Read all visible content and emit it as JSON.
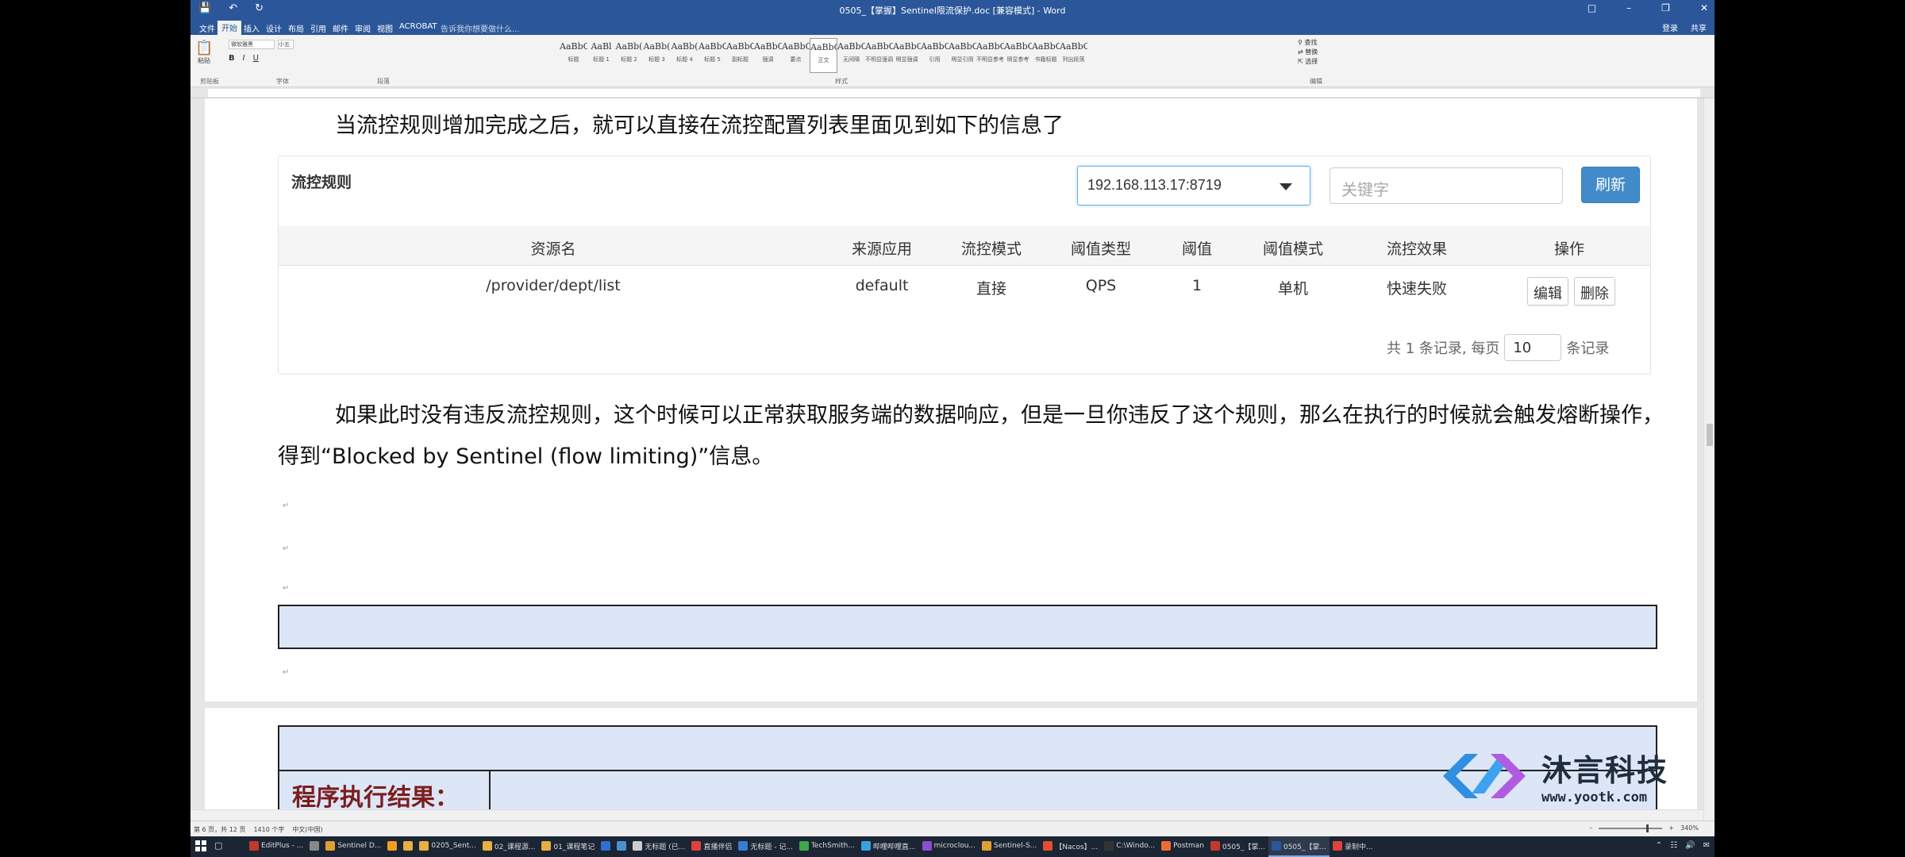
{
  "window": {
    "title": "0505_【掌握】Sentinel限流保护.doc [兼容模式] - Word",
    "login": "登录",
    "share": "共享"
  },
  "ribbon": {
    "tabs": [
      "文件",
      "开始",
      "插入",
      "设计",
      "布局",
      "引用",
      "邮件",
      "审阅",
      "视图",
      "ACROBAT"
    ],
    "active_tab": "开始",
    "tell_me": "告诉我你想要做什么...",
    "font_name": "微软雅黑",
    "font_size": "小五",
    "paste_label": "粘贴",
    "group_labels": [
      "剪贴板",
      "字体",
      "段落",
      "样式",
      "编辑"
    ],
    "styles": [
      {
        "preview": "AaBbC",
        "name": "标题"
      },
      {
        "preview": "AaBl",
        "name": "标题 1"
      },
      {
        "preview": "AaBb(",
        "name": "标题 2"
      },
      {
        "preview": "AaBb(",
        "name": "标题 3"
      },
      {
        "preview": "AaBb(",
        "name": "标题 4"
      },
      {
        "preview": "AaBbC",
        "name": "标题 5"
      },
      {
        "preview": "AaBbC",
        "name": "副标题"
      },
      {
        "preview": "AaBbCcD",
        "name": "强调"
      },
      {
        "preview": "AaBbCcD",
        "name": "要点"
      },
      {
        "preview": "AaBbCcD",
        "name": "正文"
      },
      {
        "preview": "AaBbCcD",
        "name": "无间隔"
      },
      {
        "preview": "AaBbCcD",
        "name": "不明显强调"
      },
      {
        "preview": "AaBbCcD",
        "name": "明显强调"
      },
      {
        "preview": "AaBbCcD",
        "name": "引用"
      },
      {
        "preview": "AaBbCcD",
        "name": "明显引用"
      },
      {
        "preview": "AaBbCcD",
        "name": "不明显参考"
      },
      {
        "preview": "AaBbCcI",
        "name": "明显参考"
      },
      {
        "preview": "AaBbCcD",
        "name": "书籍标题"
      },
      {
        "preview": "AaBbCcD",
        "name": "列出段落"
      }
    ],
    "edit_items": [
      "查找",
      "替换",
      "选择"
    ]
  },
  "document": {
    "para1": "当流控规则增加完成之后，就可以直接在流控配置列表里面见到如下的信息了",
    "para2": "如果此时没有违反流控规则，这个时候可以正常获取服务端的数据响应，但是一旦你违反了这个规则，那么在执行的时候就会触发熔断操作，得到“Blocked by Sentinel (flow limiting)”信息。",
    "result_label": "程序执行结果："
  },
  "flow_panel": {
    "title": "流控规则",
    "machine": "192.168.113.17:8719",
    "search_placeholder": "关键字",
    "refresh": "刷新",
    "headers": [
      "资源名",
      "来源应用",
      "流控模式",
      "阈值类型",
      "阈值",
      "阈值模式",
      "流控效果",
      "操作"
    ],
    "row": [
      "/provider/dept/list",
      "default",
      "直接",
      "QPS",
      "1",
      "单机",
      "快速失败"
    ],
    "edit": "编辑",
    "delete": "删除",
    "pager_prefix": "共 1 条记录, 每页",
    "page_size": "10",
    "pager_suffix": "条记录"
  },
  "watermark": {
    "name": "沐言科技",
    "url": "www.yootk.com"
  },
  "statusbar": {
    "page": "第 6 页，共 12 页",
    "words": "1410 个字",
    "lang": "中文(中国)",
    "zoom": "340%"
  },
  "taskbar": {
    "items": [
      {
        "label": "EditPlus - ...",
        "color": "#c0392b"
      },
      {
        "label": "",
        "color": "#888888"
      },
      {
        "label": "Sentinel D...",
        "color": "#e0a030"
      },
      {
        "label": "",
        "color": "#f0a020"
      },
      {
        "label": "",
        "color": "#e8b040"
      },
      {
        "label": "0205_Sent...",
        "color": "#e8b040"
      },
      {
        "label": "02_课程源...",
        "color": "#e8b040"
      },
      {
        "label": "01_课程笔记",
        "color": "#e8b040"
      },
      {
        "label": "",
        "color": "#2f6fd0"
      },
      {
        "label": "",
        "color": "#4a90d0"
      },
      {
        "label": "无标题 (已...",
        "color": "#cccccc"
      },
      {
        "label": "直播伴侣",
        "color": "#e04040"
      },
      {
        "label": "无标题 - 记...",
        "color": "#3a7bd5"
      },
      {
        "label": "TechSmith...",
        "color": "#3fa64a"
      },
      {
        "label": "哔哩哔哩直...",
        "color": "#3aa0e0"
      },
      {
        "label": "microclou...",
        "color": "#8a4fd0"
      },
      {
        "label": "Sentinel-S...",
        "color": "#e0a030"
      },
      {
        "label": "【Nacos】...",
        "color": "#e05030"
      },
      {
        "label": "C:\\Windo...",
        "color": "#333333"
      },
      {
        "label": "Postman",
        "color": "#ef6c2f"
      },
      {
        "label": "0505_【掌...",
        "color": "#c0392b"
      },
      {
        "label": "0505_【掌...",
        "color": "#2b579a"
      },
      {
        "label": "录制中...",
        "color": "#e04040"
      }
    ]
  }
}
